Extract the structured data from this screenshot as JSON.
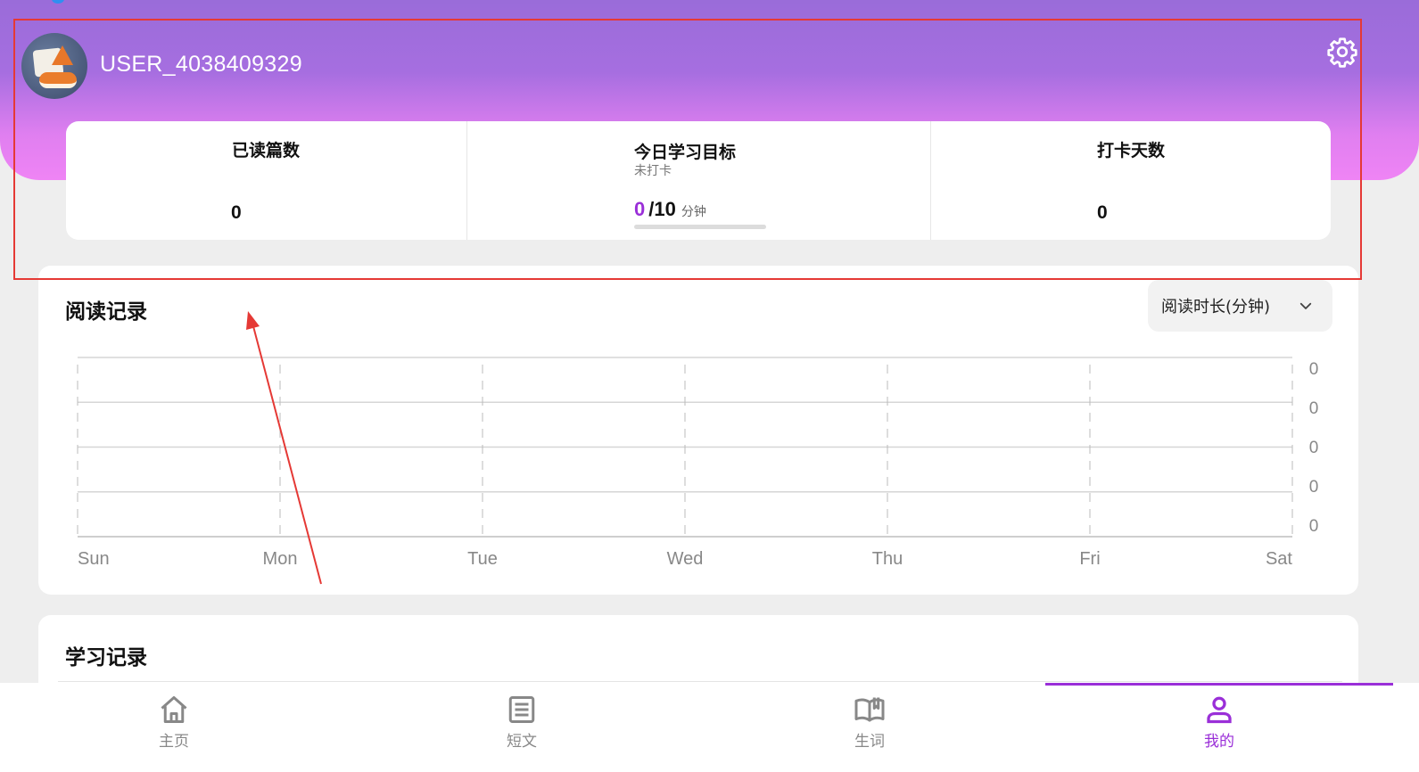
{
  "header": {
    "username": "USER_4038409329",
    "avatar": "fox-avatar",
    "settings_icon": "gear-icon",
    "gradient_colors": [
      "#9a6cd9",
      "#ef84f5"
    ]
  },
  "stats": {
    "read_count": {
      "label": "已读篇数",
      "value": "0"
    },
    "daily_goal": {
      "label": "今日学习目标",
      "status": "未打卡",
      "current": "0",
      "target": "/10",
      "unit": "分钟",
      "progress": 0
    },
    "checkin_days": {
      "label": "打卡天数",
      "value": "0"
    }
  },
  "reading_record": {
    "title": "阅读记录",
    "metric_select": {
      "selected": "阅读时长(分钟)",
      "icon": "chevron-down-icon"
    }
  },
  "chart_data": {
    "type": "line",
    "categories": [
      "Sun",
      "Mon",
      "Tue",
      "Wed",
      "Thu",
      "Fri",
      "Sat"
    ],
    "series": [
      {
        "values": [
          0,
          0,
          0,
          0,
          0,
          0,
          0
        ]
      }
    ],
    "y_tick_labels": [
      "0",
      "0",
      "0",
      "0",
      "0"
    ],
    "y_axis_position": "right",
    "grid": true,
    "title": "",
    "xlabel": "",
    "ylabel": ""
  },
  "learning_record": {
    "title": "学习记录"
  },
  "tabbar": {
    "items": [
      {
        "label": "主页",
        "icon": "home-icon"
      },
      {
        "label": "短文",
        "icon": "article-icon"
      },
      {
        "label": "生词",
        "icon": "book-icon"
      },
      {
        "label": "我的",
        "icon": "person-icon"
      }
    ],
    "active_index": 3,
    "active_color": "#9a2fd8",
    "inactive_color": "#888888"
  },
  "annotation": {
    "box_color": "#e53935",
    "arrow_color": "#e53935"
  }
}
